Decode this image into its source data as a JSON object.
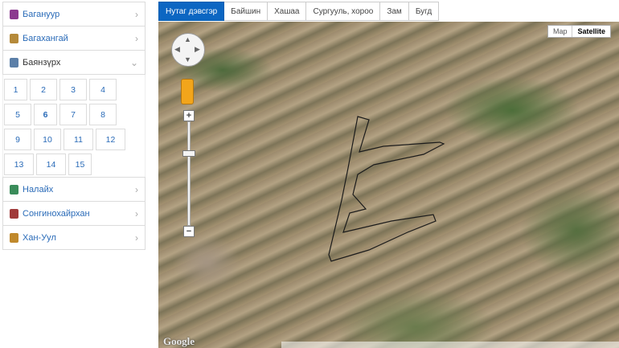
{
  "sidebar": {
    "districts": [
      {
        "name": "Багануур",
        "color": "#8b3a8f",
        "expanded": false,
        "chevron": "›"
      },
      {
        "name": "Багахангай",
        "color": "#b58a3a",
        "expanded": false,
        "chevron": "›"
      },
      {
        "name": "Баянзүрх",
        "color": "#5b7fa8",
        "expanded": true,
        "chevron": "⌄"
      },
      {
        "name": "Налайх",
        "color": "#3a8c5a",
        "expanded": false,
        "chevron": "›"
      },
      {
        "name": "Сонгинохайрхан",
        "color": "#a03a3a",
        "expanded": false,
        "chevron": "›"
      },
      {
        "name": "Хан-Уул",
        "color": "#c0892c",
        "expanded": false,
        "chevron": "›"
      }
    ],
    "khoroos": [
      "1",
      "2",
      "3",
      "4",
      "5",
      "6",
      "7",
      "8",
      "9",
      "10",
      "11",
      "12",
      "13",
      "14",
      "15"
    ],
    "active_khoroo": "6"
  },
  "tabs": [
    {
      "label": "Нутаг дэвсгэр",
      "active": true
    },
    {
      "label": "Байшин",
      "active": false
    },
    {
      "label": "Хашаа",
      "active": false
    },
    {
      "label": "Сургууль, хороо",
      "active": false
    },
    {
      "label": "Зам",
      "active": false
    },
    {
      "label": "Бугд",
      "active": false
    }
  ],
  "map": {
    "type_buttons": [
      {
        "label": "Map",
        "active": false
      },
      {
        "label": "Satellite",
        "active": true
      }
    ],
    "zoom_in": "+",
    "zoom_out": "−",
    "logo": "Google",
    "pan_arrows": {
      "up": "▲",
      "down": "▼",
      "left": "◀",
      "right": "▶"
    }
  }
}
